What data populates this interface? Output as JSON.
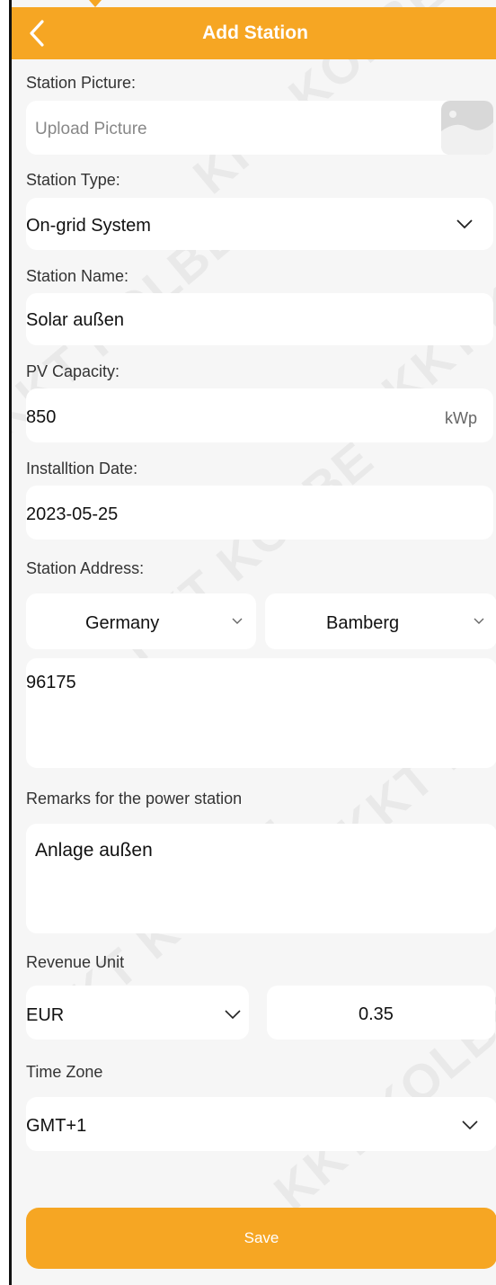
{
  "header": {
    "title": "Add Station",
    "back_icon": "chevron-left-icon"
  },
  "station_picture": {
    "label": "Station Picture:",
    "placeholder": "Upload Picture",
    "icon": "image-icon"
  },
  "station_type": {
    "label": "Station Type:",
    "value": "On-grid System",
    "icon": "chevron-down-icon"
  },
  "station_name": {
    "label": "Station Name:",
    "value": "Solar außen"
  },
  "pv_capacity": {
    "label": "PV Capacity:",
    "value": "850",
    "unit": "kWp"
  },
  "installation_date": {
    "label": "Installtion Date:",
    "value": "2023-05-25"
  },
  "station_address": {
    "label": "Station Address:",
    "country": "Germany",
    "city": "Bamberg",
    "address": "96175"
  },
  "remarks": {
    "label": "Remarks for the power station",
    "value": "Anlage außen"
  },
  "revenue_unit": {
    "label": "Revenue Unit",
    "currency": "EUR",
    "price": "0.35"
  },
  "time_zone": {
    "label": "Time Zone",
    "value": "GMT+1"
  },
  "save_label": "Save",
  "watermark": "KKT KOLBE",
  "colors": {
    "accent": "#f6a623",
    "background": "#f6f6f6",
    "field": "#ffffff"
  }
}
